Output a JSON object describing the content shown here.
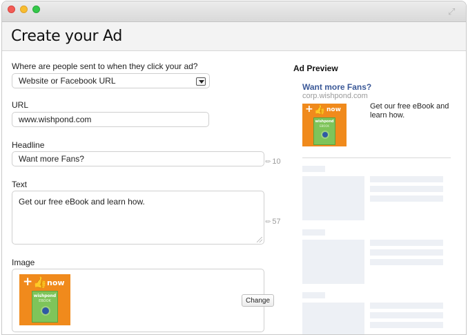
{
  "window": {
    "controls": [
      "close",
      "minimize",
      "zoom"
    ],
    "expand_icon": "expand-icon"
  },
  "header": {
    "title": "Create your Ad"
  },
  "form": {
    "destination": {
      "label": "Where are people sent to when they click your ad?",
      "value": "Website or Facebook URL"
    },
    "url": {
      "label": "URL",
      "value": "www.wishpond.com"
    },
    "headline": {
      "label": "Headline",
      "value": "Want more Fans?",
      "remaining": "10"
    },
    "text": {
      "label": "Text",
      "value": "Get our free eBook and learn how.",
      "remaining": "57"
    },
    "image": {
      "label": "Image",
      "change_label": "Change"
    }
  },
  "ad_image": {
    "plus": "+",
    "now": "now",
    "brand": "wishpond",
    "ebook": "EBOOK"
  },
  "preview": {
    "title": "Ad Preview",
    "headline": "Want more Fans?",
    "domain": "corp.wishpond.com",
    "body": "Get our free eBook and learn how."
  },
  "colors": {
    "accent_link": "#3b5998",
    "ad_orange": "#f08a1c",
    "ad_green": "#7ec45a",
    "placeholder": "#edf0f5"
  }
}
